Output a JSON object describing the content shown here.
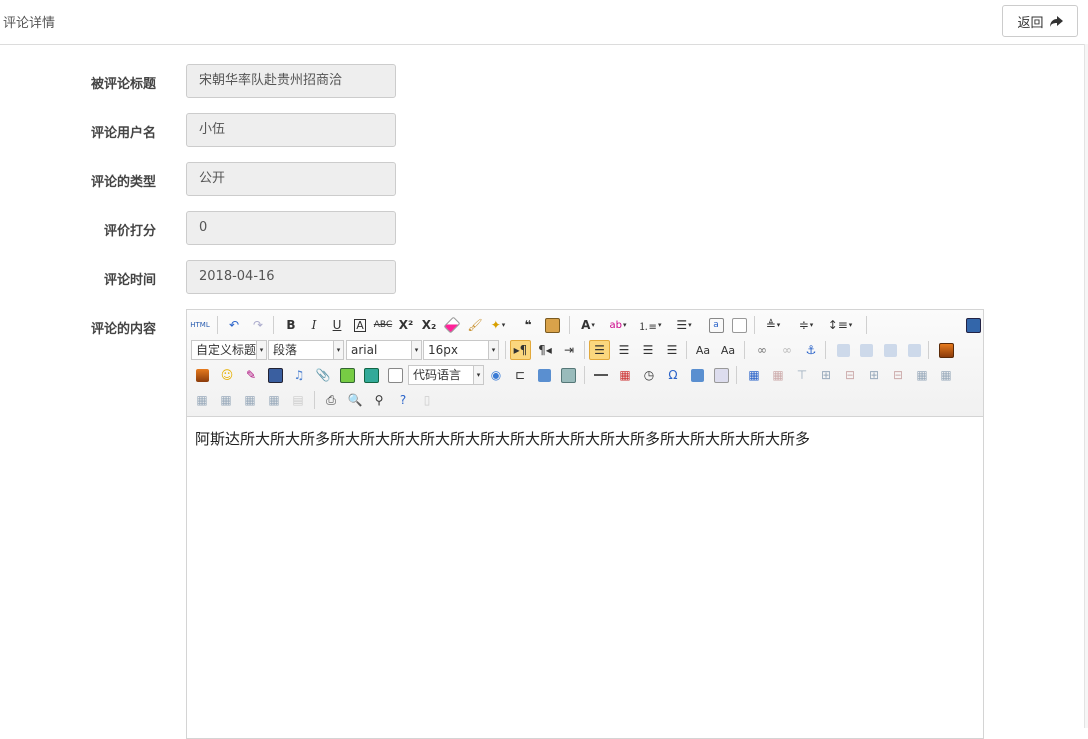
{
  "header": {
    "title": "评论详情",
    "back_label": "返回"
  },
  "fields": [
    {
      "label": "被评论标题",
      "value": "宋朝华率队赴贵州招商洽"
    },
    {
      "label": "评论用户名",
      "value": "小伍"
    },
    {
      "label": "评论的类型",
      "value": "公开"
    },
    {
      "label": "评价打分",
      "value": "0"
    },
    {
      "label": "评论时间",
      "value": "2018-04-16"
    }
  ],
  "content": {
    "label": "评论的内容",
    "text": "阿斯达所大所大所多所大所大所大所大所大所大所大所大所大所大所多所大所大所大所大所多"
  },
  "toolbar": {
    "html_label": "HTML",
    "custom_title": "自定义标题",
    "paragraph": "段落",
    "font_family": "arial",
    "font_size": "16px",
    "code_language": "代码语言"
  }
}
